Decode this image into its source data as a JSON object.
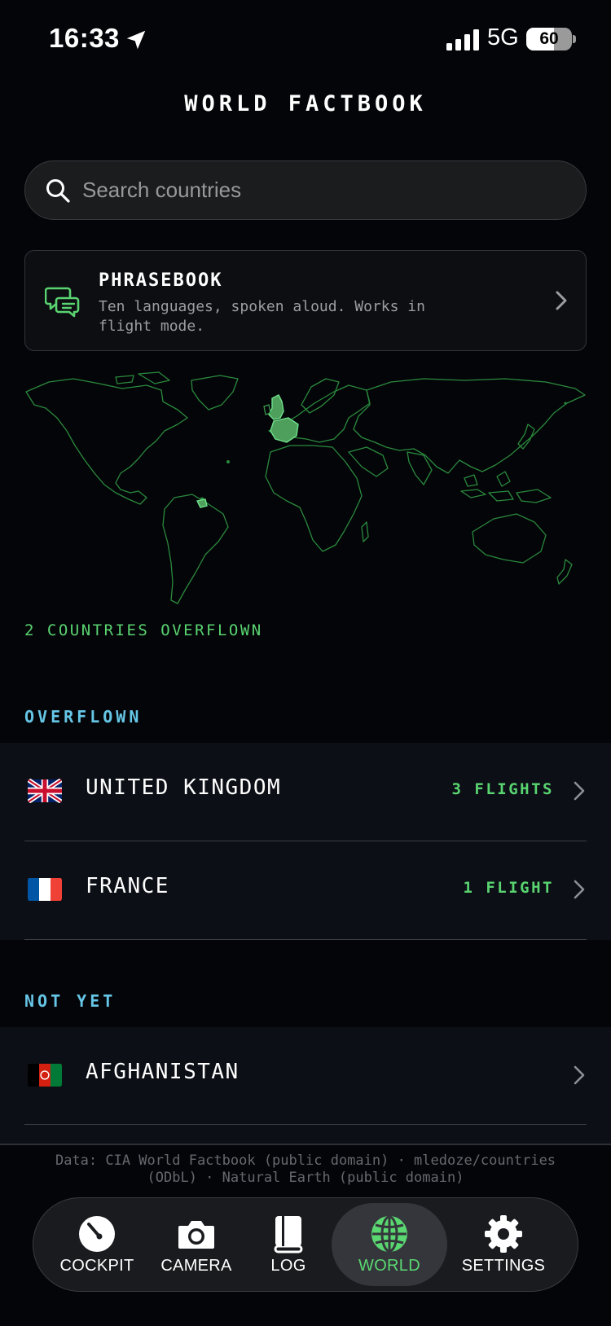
{
  "status_bar": {
    "time": "16:33",
    "network": "5G",
    "battery_level": 60,
    "battery_text": "60"
  },
  "header": {
    "title": "WORLD FACTBOOK"
  },
  "search": {
    "placeholder": "Search countries",
    "value": ""
  },
  "phrasebook": {
    "title": "PHRASEBOOK",
    "description": "Ten languages, spoken aloud. Works in flight mode."
  },
  "map": {
    "caption": "2 COUNTRIES OVERFLOWN",
    "highlighted_countries": [
      "United Kingdom",
      "France"
    ],
    "land_outline_color": "#2a8a3d",
    "highlight_color": "#4e9f5c"
  },
  "sections": {
    "overflown": {
      "label": "OVERFLOWN",
      "rows": [
        {
          "flag": "united-kingdom-flag",
          "name": "UNITED KINGDOM",
          "count": "3 FLIGHTS"
        },
        {
          "flag": "france-flag",
          "name": "FRANCE",
          "count": "1 FLIGHT"
        }
      ]
    },
    "not_yet": {
      "label": "NOT YET",
      "rows": [
        {
          "flag": "afghanistan-flag",
          "name": "AFGHANISTAN",
          "count": ""
        }
      ]
    }
  },
  "footer": {
    "attribution": "Data: CIA World Factbook (public domain) · mledoze/countries (ODbL) · Natural Earth (public domain)"
  },
  "tab_bar": {
    "tabs": [
      {
        "label": "COCKPIT",
        "icon": "gauge-icon"
      },
      {
        "label": "CAMERA",
        "icon": "camera-icon"
      },
      {
        "label": "LOG",
        "icon": "book-icon"
      },
      {
        "label": "WORLD",
        "icon": "globe-icon"
      },
      {
        "label": "SETTINGS",
        "icon": "gear-icon"
      }
    ],
    "active": "WORLD"
  },
  "colors": {
    "accent_green": "#59d470",
    "section_blue": "#66c6e6",
    "background": "#040509",
    "row_background": "#0c0f16"
  }
}
